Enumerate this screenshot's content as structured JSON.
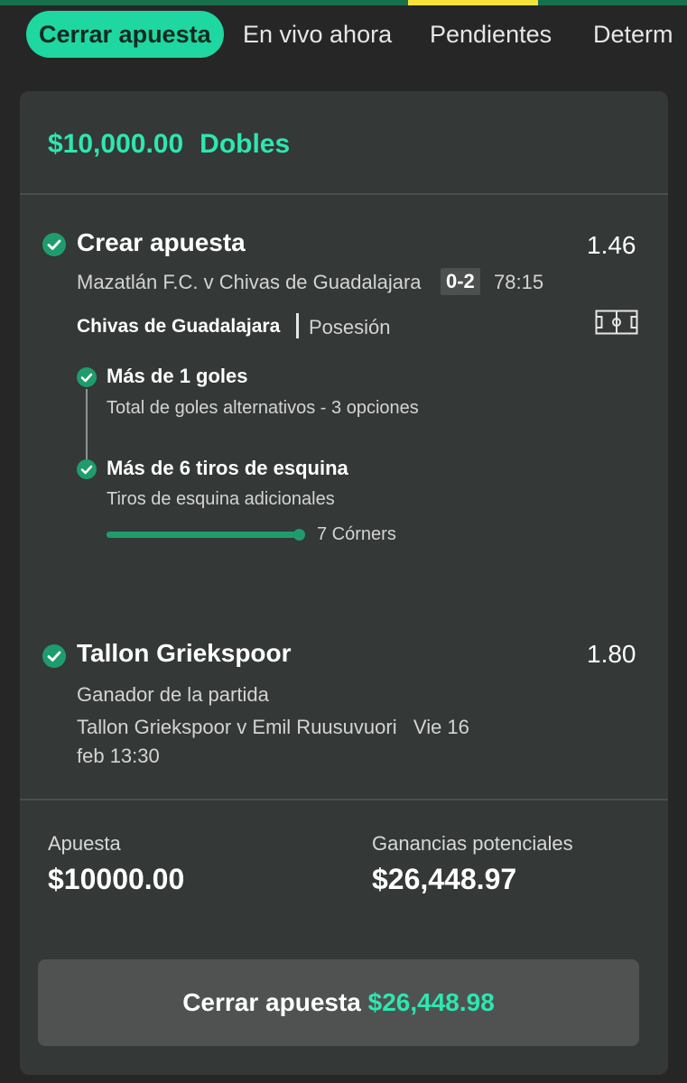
{
  "tabs": [
    {
      "label": "Cerrar apuesta",
      "active": true
    },
    {
      "label": "En vivo ahora"
    },
    {
      "label": "Pendientes"
    },
    {
      "label": "Determ"
    }
  ],
  "bet": {
    "stake_title": "$10,000.00",
    "type": "Dobles"
  },
  "selections": [
    {
      "title": "Crear apuesta",
      "odds": "1.46",
      "match": "Mazatlán F.C. v Chivas de Guadalajara",
      "score": "0-2",
      "clock": "78:15",
      "team": "Chivas de Guadalajara",
      "stat": "Posesión",
      "legs": [
        {
          "title": "Más de 1 goles",
          "desc": "Total de goles alternativos - 3 opciones"
        },
        {
          "title": "Más de 6 tiros de esquina",
          "desc": "Tiros de esquina adicionales",
          "progress_label": "7 Córners",
          "progress_fraction": 1.0
        }
      ]
    },
    {
      "title": "Tallon Griekspoor",
      "odds": "1.80",
      "market": "Ganador de la partida",
      "match_line1": "Tallon Griekspoor v Emil Ruusuvuori   Vie 16",
      "match_line2": "feb 13:30"
    }
  ],
  "summary": {
    "stake_label": "Apuesta",
    "stake_value": "$10000.00",
    "returns_label": "Ganancias potenciales",
    "returns_value": "$26,448.97"
  },
  "cashout": {
    "label": "Cerrar apuesta",
    "amount": "$26,448.98"
  },
  "colors": {
    "accent": "#2ee6b0",
    "pill": "#1fd7a0",
    "check": "#1f9c6d",
    "card": "#343836",
    "background": "#262626",
    "tab_indicator": "#f5e33a"
  },
  "icons": [
    "check-circle-icon",
    "soccer-field-icon"
  ]
}
